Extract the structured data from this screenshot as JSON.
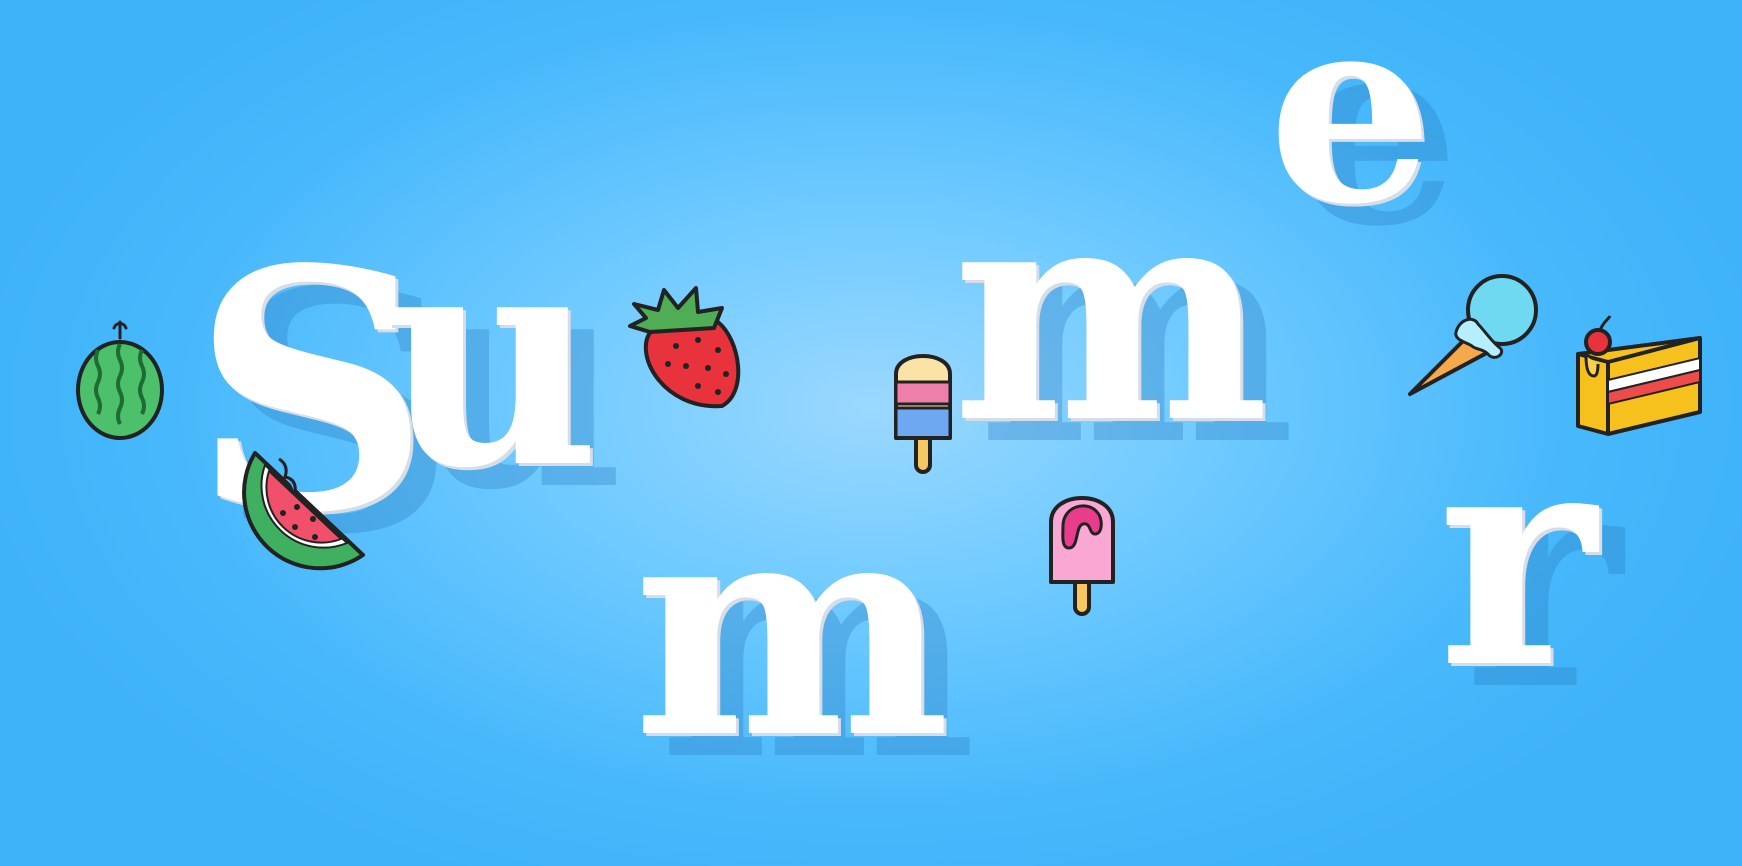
{
  "letters": {
    "s": "S",
    "u": "u",
    "m1": "m",
    "m2": "m",
    "e": "e",
    "r": "r"
  },
  "icons": [
    "melon-icon",
    "watermelon-slice-icon",
    "strawberry-icon",
    "popsicle-striped-icon",
    "popsicle-pink-icon",
    "ice-cream-cone-icon",
    "cake-slice-icon"
  ],
  "colors": {
    "background": "#47b8fb",
    "letter": "#ffffff"
  }
}
